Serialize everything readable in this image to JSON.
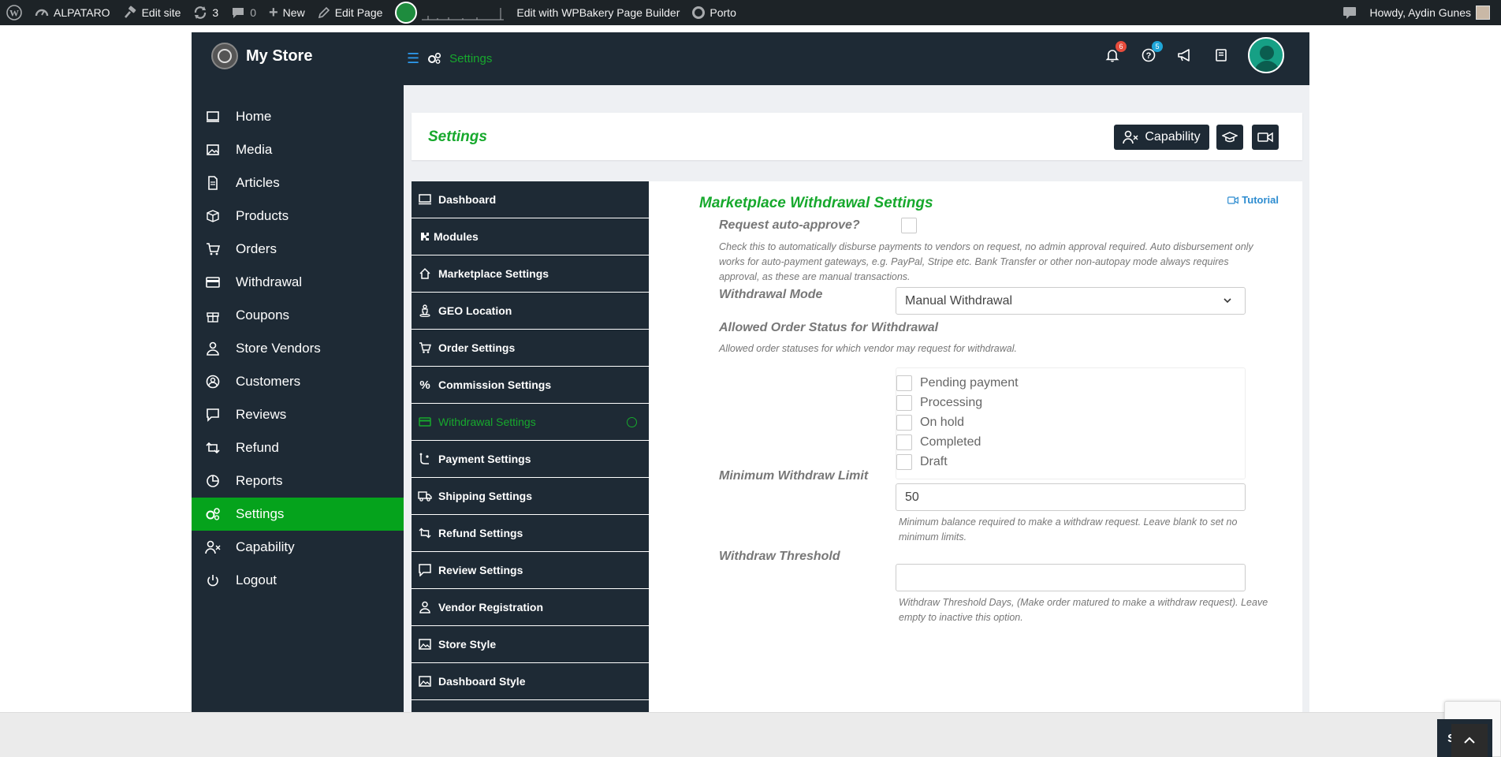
{
  "adminbar": {
    "site_name": "ALPATARO",
    "edit_site": "Edit site",
    "updates_count": "3",
    "comments_count": "0",
    "new_label": "New",
    "edit_page": "Edit Page",
    "wpbakery": "Edit with WPBakery Page Builder",
    "theme": "Porto",
    "howdy": "Howdy, Aydin Gunes"
  },
  "topbar": {
    "store_name": "My Store",
    "breadcrumb": "Settings",
    "notifications_count": "6",
    "help_count": "5"
  },
  "leftnav": {
    "items": [
      {
        "label": "Home",
        "icon": "monitor-icon"
      },
      {
        "label": "Media",
        "icon": "image-icon"
      },
      {
        "label": "Articles",
        "icon": "document-icon"
      },
      {
        "label": "Products",
        "icon": "cube-icon"
      },
      {
        "label": "Orders",
        "icon": "cart-icon"
      },
      {
        "label": "Withdrawal",
        "icon": "credit-card-icon"
      },
      {
        "label": "Coupons",
        "icon": "gift-icon"
      },
      {
        "label": "Store Vendors",
        "icon": "user-icon"
      },
      {
        "label": "Customers",
        "icon": "user-circle-icon"
      },
      {
        "label": "Reviews",
        "icon": "comment-icon"
      },
      {
        "label": "Refund",
        "icon": "retweet-icon"
      },
      {
        "label": "Reports",
        "icon": "pie-chart-icon"
      },
      {
        "label": "Settings",
        "icon": "cogs-icon"
      },
      {
        "label": "Capability",
        "icon": "user-x-icon"
      },
      {
        "label": "Logout",
        "icon": "power-icon"
      }
    ]
  },
  "header": {
    "title": "Settings",
    "capability_button": "Capability"
  },
  "submenu": {
    "items": [
      {
        "label": "Dashboard"
      },
      {
        "label": "Modules"
      },
      {
        "label": "Marketplace Settings"
      },
      {
        "label": "GEO Location"
      },
      {
        "label": "Order Settings"
      },
      {
        "label": "Commission Settings"
      },
      {
        "label": "Withdrawal Settings"
      },
      {
        "label": "Payment Settings"
      },
      {
        "label": "Shipping Settings"
      },
      {
        "label": "Refund Settings"
      },
      {
        "label": "Review Settings"
      },
      {
        "label": "Vendor Registration"
      },
      {
        "label": "Store Style"
      },
      {
        "label": "Dashboard Style"
      }
    ]
  },
  "form": {
    "section_title": "Marketplace Withdrawal Settings",
    "tutorial": "Tutorial",
    "auto_approve_label": "Request auto-approve?",
    "auto_approve_desc": "Check this to automatically disburse payments to vendors on request, no admin approval required. Auto disbursement only works for auto-payment gateways, e.g. PayPal, Stripe etc. Bank Transfer or other non-autopay mode always requires approval, as these are manual transactions.",
    "withdrawal_mode_label": "Withdrawal Mode",
    "withdrawal_mode_value": "Manual Withdrawal",
    "allowed_status_label": "Allowed Order Status for Withdrawal",
    "allowed_status_desc": "Allowed order statuses for which vendor may request for withdrawal.",
    "statuses": [
      "Pending payment",
      "Processing",
      "On hold",
      "Completed",
      "Draft"
    ],
    "min_limit_label": "Minimum Withdraw Limit",
    "min_limit_value": "50",
    "min_limit_desc": "Minimum balance required to make a withdraw request. Leave blank to set no minimum limits.",
    "threshold_label": "Withdraw Threshold",
    "threshold_value": "",
    "threshold_desc": "Withdraw Threshold Days, (Make order matured to make a withdraw request). Leave empty to inactive this option."
  },
  "footer": {
    "save": "SAVE"
  },
  "colors": {
    "accent_green": "#17a92d",
    "active_green": "#05a31c",
    "dark_navy": "#1e2a35",
    "link_blue": "#2d8cd0"
  }
}
